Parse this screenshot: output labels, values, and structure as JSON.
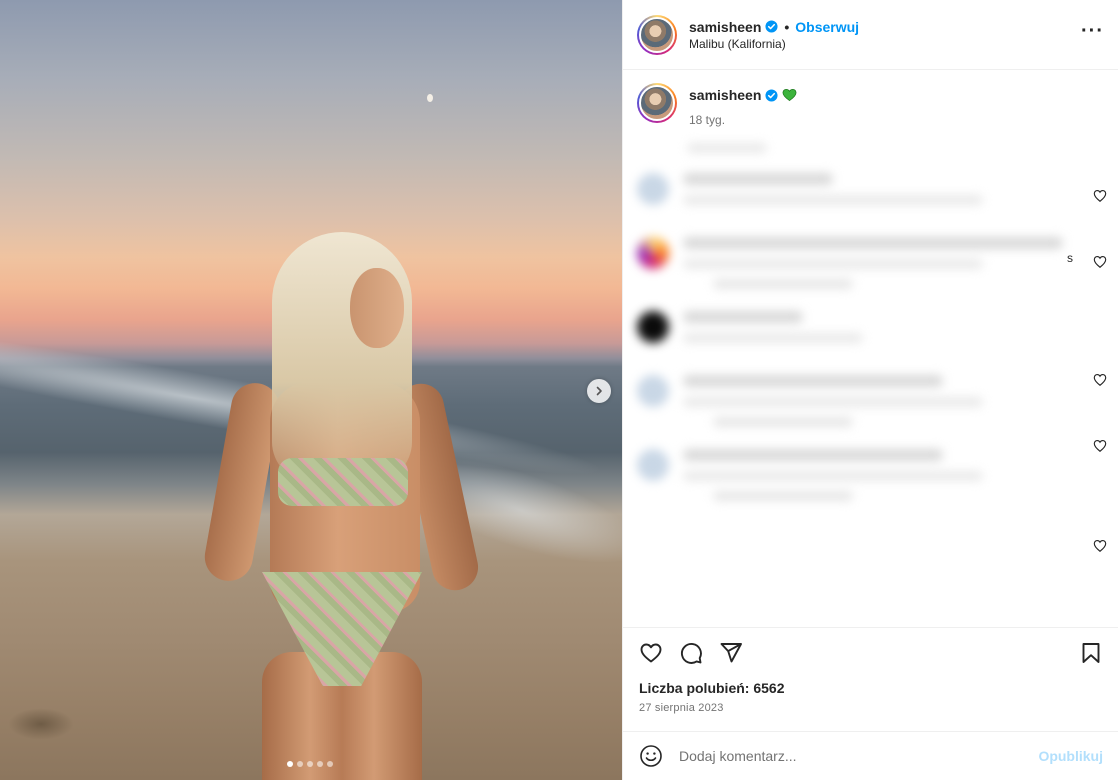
{
  "post": {
    "author": "samisheen",
    "follow_label": "Obserwuj",
    "separator": "•",
    "location": "Malibu (Kalifornia)",
    "more_label": "···",
    "carousel": {
      "slide_count": 5,
      "active_index": 0
    }
  },
  "caption": {
    "author": "samisheen",
    "emoji": "green-heart-icon",
    "time": "18 tyg."
  },
  "comments": {
    "blurred": true,
    "stray_text": "s"
  },
  "engagement": {
    "likes_text": "Liczba polubień: 6562",
    "date": "27 sierpnia 2023"
  },
  "composer": {
    "placeholder": "Dodaj komentarz...",
    "publish_label": "Opublikuj"
  },
  "colors": {
    "accent": "#0095f6",
    "publish_disabled": "#b2dffc",
    "verified": "#0095f6",
    "heart_emoji": "#3cb43c"
  }
}
